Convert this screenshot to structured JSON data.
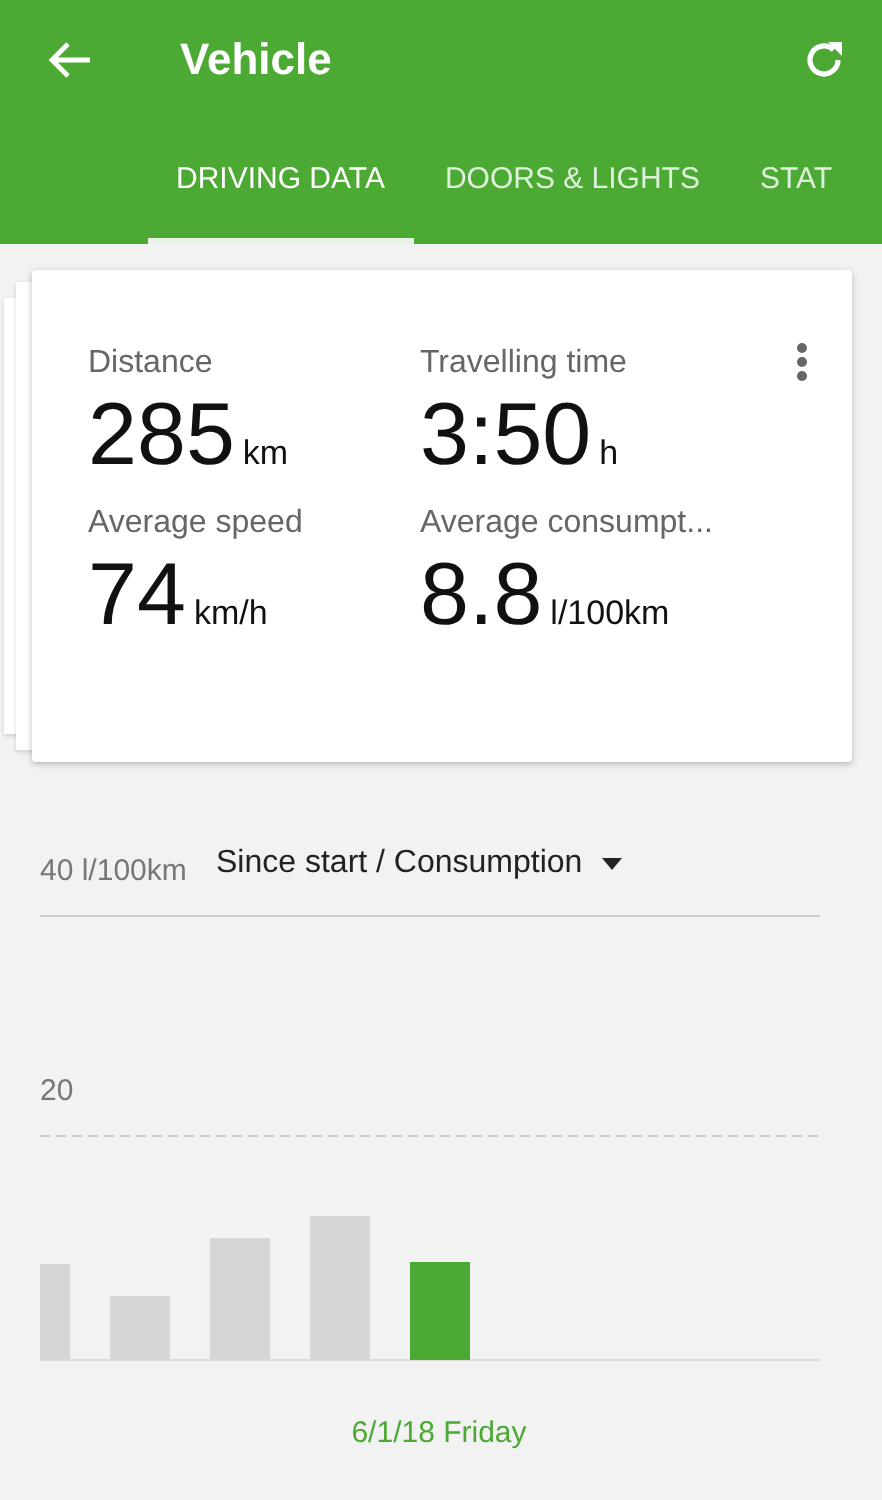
{
  "app_bar": {
    "title": "Vehicle"
  },
  "tabs": [
    {
      "label": "DRIVING DATA",
      "selected": true
    },
    {
      "label": "DOORS & LIGHTS",
      "selected": false
    },
    {
      "label": "STAT",
      "selected": false
    }
  ],
  "stats": [
    {
      "label": "Distance",
      "value": "285",
      "unit": "km"
    },
    {
      "label": "Travelling time",
      "value": "3:50",
      "unit": "h"
    },
    {
      "label": "Average speed",
      "value": "74",
      "unit": "km/h"
    },
    {
      "label": "Average consumpt...",
      "value": "8.8",
      "unit": "l/100km"
    }
  ],
  "chart": {
    "selector": "Since start / Consumption",
    "axis_labels": [
      "40 l/100km",
      "20"
    ],
    "selected_label": "6/1/18 Friday",
    "bars": [
      {
        "selected": false
      },
      {
        "selected": false
      },
      {
        "selected": false
      },
      {
        "selected": false
      },
      {
        "selected": true
      }
    ]
  }
}
